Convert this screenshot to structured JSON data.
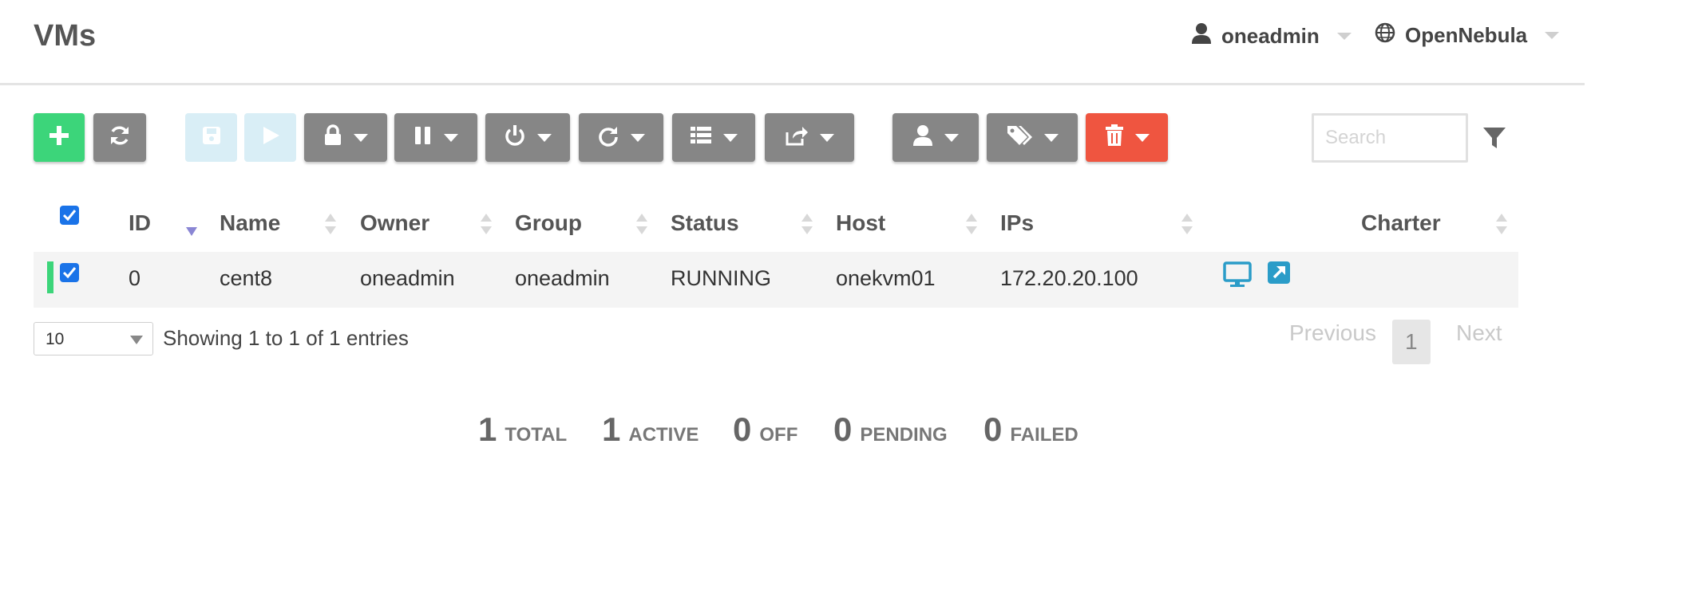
{
  "page": {
    "title": "VMs"
  },
  "header": {
    "user": "oneadmin",
    "zone": "OpenNebula"
  },
  "toolbar": {
    "buttons": [
      {
        "icon": "plus-icon",
        "color": "#3cd57a"
      },
      {
        "icon": "refresh-icon",
        "color": "#868686"
      },
      {
        "icon": "save-icon",
        "color": "#d9eef6"
      },
      {
        "icon": "play-icon",
        "color": "#d9eef6"
      },
      {
        "icon": "lock-icon",
        "color": "#868686"
      },
      {
        "icon": "pause-icon",
        "color": "#868686"
      },
      {
        "icon": "power-icon",
        "color": "#868686"
      },
      {
        "icon": "redo-icon",
        "color": "#868686"
      },
      {
        "icon": "list-icon",
        "color": "#868686"
      },
      {
        "icon": "share-icon",
        "color": "#868686"
      },
      {
        "icon": "user-icon",
        "color": "#868686"
      },
      {
        "icon": "tags-icon",
        "color": "#868686"
      },
      {
        "icon": "trash-icon",
        "color": "#ef5540"
      }
    ]
  },
  "search": {
    "placeholder": "Search"
  },
  "table": {
    "columns": [
      "ID",
      "Name",
      "Owner",
      "Group",
      "Status",
      "Host",
      "IPs",
      "Charter"
    ],
    "rows": [
      {
        "id": "0",
        "name": "cent8",
        "owner": "oneadmin",
        "group": "oneadmin",
        "status": "RUNNING",
        "host": "onekvm01",
        "ips": "172.20.20.100",
        "status_color": "#3cd57a",
        "actions": [
          "monitor-icon",
          "external-link-icon"
        ]
      }
    ]
  },
  "footer": {
    "page_size": "10",
    "info": "Showing 1 to 1 of 1 entries",
    "previous": "Previous",
    "current_page": "1",
    "next": "Next"
  },
  "stats": [
    {
      "num": "1",
      "label": "TOTAL"
    },
    {
      "num": "1",
      "label": "ACTIVE"
    },
    {
      "num": "0",
      "label": "OFF"
    },
    {
      "num": "0",
      "label": "PENDING"
    },
    {
      "num": "0",
      "label": "FAILED"
    }
  ]
}
